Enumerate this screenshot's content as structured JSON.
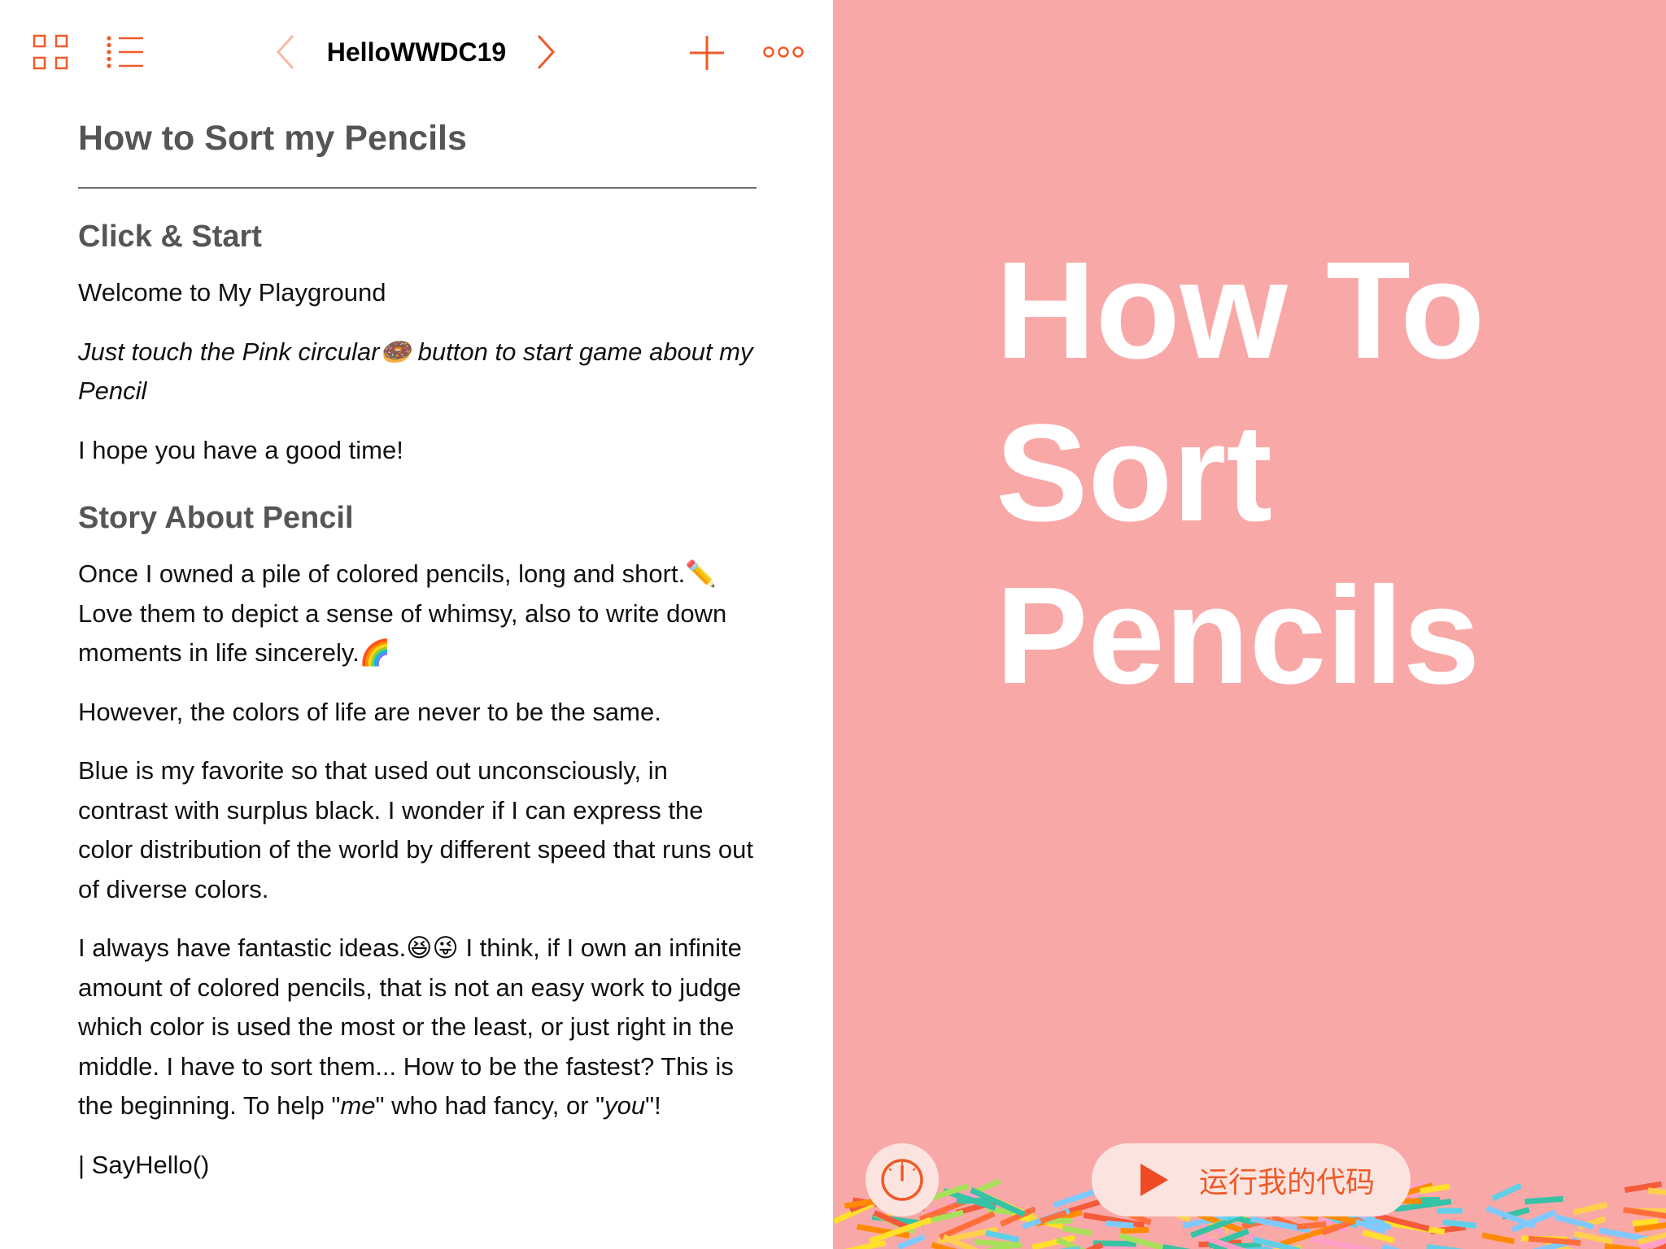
{
  "toolbar": {
    "title": "HelloWWDC19",
    "icons": {
      "grid": "grid-icon",
      "list": "list-icon",
      "prev": "chevron-left-icon",
      "next": "chevron-right-icon",
      "add": "plus-icon",
      "more": "more-icon"
    }
  },
  "document": {
    "heading": "How to Sort my Pencils",
    "sections": [
      {
        "title": "Click & Start",
        "p1": "Welcome to My Playground",
        "p2": "Just touch the Pink circular🍩 button to start game about my Pencil",
        "p3": "I hope you have a good time!"
      },
      {
        "title": "Story About Pencil",
        "p1": "Once I owned a pile of colored pencils, long and short.✏️ Love them to depict a sense of whimsy, also to write down moments in life sincerely.🌈",
        "p2": "However, the colors of life are never to be the same.",
        "p3": "Blue is my favorite so that used out unconsciously, in contrast with surplus black. I wonder if I can express the color distribution of the world by different speed that runs out of diverse colors.",
        "p4_a": "I always have fantastic ideas.😆😜 I think, if I own an infinite amount of colored pencils, that is not an easy work to judge which color is used the most or the least, or just right in the middle. I have to sort them... How to be the fastest? This is the beginning. To help \"",
        "p4_me": "me",
        "p4_b": "\" who had fancy, or \"",
        "p4_you": "you",
        "p4_c": "\"!"
      }
    ],
    "code": "| SayHello()"
  },
  "live_view": {
    "title_lines": [
      "How To",
      "Sort",
      "Pencils"
    ],
    "background_color": "#f9a8a8",
    "pencil_colors": [
      "#ff6f3c",
      "#ffe02a",
      "#5fd0e8",
      "#ff9fc8",
      "#36c2a4",
      "#ffd04d",
      "#f55a3b",
      "#7ec9ff",
      "#a8e05a",
      "#ff8a00"
    ],
    "speed_icon": "speedometer-icon",
    "run_icon": "play-icon",
    "run_label": "运行我的代码"
  },
  "accent_color": "#f05a28"
}
